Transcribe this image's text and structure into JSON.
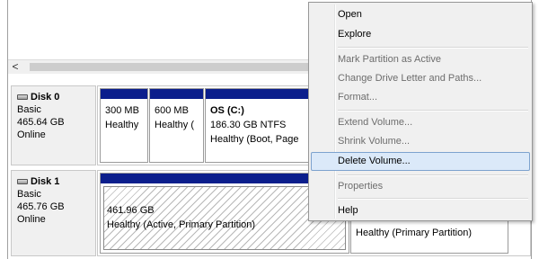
{
  "disks": [
    {
      "name": "Disk 0",
      "type": "Basic",
      "size": "465.64 GB",
      "status": "Online",
      "partitions": [
        {
          "line1": "300 MB",
          "line2": "Healthy"
        },
        {
          "line1": "600 MB",
          "line2": "Healthy ("
        },
        {
          "title": "OS  (C:)",
          "line1": "186.30 GB NTFS",
          "line2": "Healthy (Boot, Page"
        }
      ]
    },
    {
      "name": "Disk 1",
      "type": "Basic",
      "size": "465.76 GB",
      "status": "Online",
      "partitions": [
        {
          "line1": "461.96 GB",
          "line2": "Healthy (Active, Primary Partition)"
        },
        {
          "line2": "Healthy (Primary Partition)"
        }
      ]
    }
  ],
  "scrollbar": {
    "left_arrow": "<"
  },
  "context_menu": {
    "items": [
      {
        "label": "Open",
        "enabled": true
      },
      {
        "label": "Explore",
        "enabled": true
      },
      {
        "label": "Mark Partition as Active",
        "enabled": false
      },
      {
        "label": "Change Drive Letter and Paths...",
        "enabled": false
      },
      {
        "label": "Format...",
        "enabled": false
      },
      {
        "label": "Extend Volume...",
        "enabled": false
      },
      {
        "label": "Shrink Volume...",
        "enabled": false
      },
      {
        "label": "Delete Volume...",
        "enabled": true,
        "highlighted": true
      },
      {
        "label": "Properties",
        "enabled": false
      },
      {
        "label": "Help",
        "enabled": true
      }
    ]
  },
  "colors": {
    "partition_bar": "#0b1e8c",
    "menu_highlight": "#dbe9f9"
  }
}
